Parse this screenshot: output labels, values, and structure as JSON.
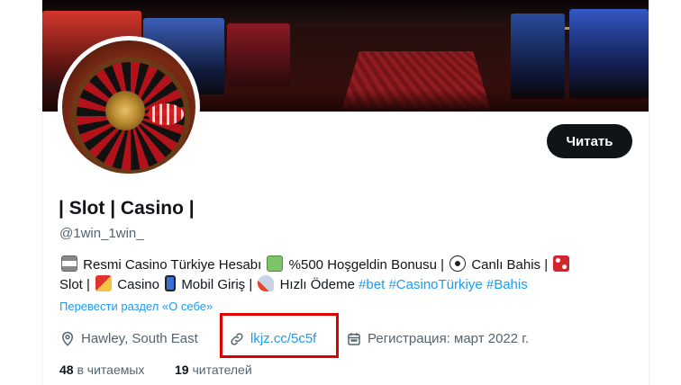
{
  "profile": {
    "name": "| Slot | Casino |",
    "handle": "@1win_1win_",
    "follow_label": "Читать",
    "bio": {
      "line1_a": "Resmi Casino Türkiye Hesabı",
      "line1_b": "%500 Hoşgeldin Bonusu | ",
      "line1_c": "Canlı Bahis |",
      "line2_a": "Slot |",
      "line2_b": "Casino",
      "line2_c": "Mobil Giriş |",
      "line2_d": "Hızlı Ödeme",
      "hashtags": [
        "#bet",
        "#CasinoTürkiye",
        "#Bahis"
      ]
    },
    "translate_label": "Перевести раздел «О себе»",
    "location": "Hawley, South East",
    "link": "lkjz.cc/5c5f",
    "joined": "Регистрация: март 2022 г.",
    "following_count": "48",
    "following_label": "в читаемых",
    "followers_count": "19",
    "followers_label": "читателей"
  },
  "colors": {
    "accent": "#1d9bf0",
    "text": "#0f1419",
    "muted": "#536471",
    "highlight": "#e00000"
  },
  "icons": [
    "location-pin-icon",
    "link-icon",
    "calendar-icon",
    "slot-machine-emoji",
    "money-emoji",
    "soccer-ball-emoji",
    "dice-emoji",
    "joker-emoji",
    "mobile-phone-emoji",
    "rocket-emoji"
  ]
}
